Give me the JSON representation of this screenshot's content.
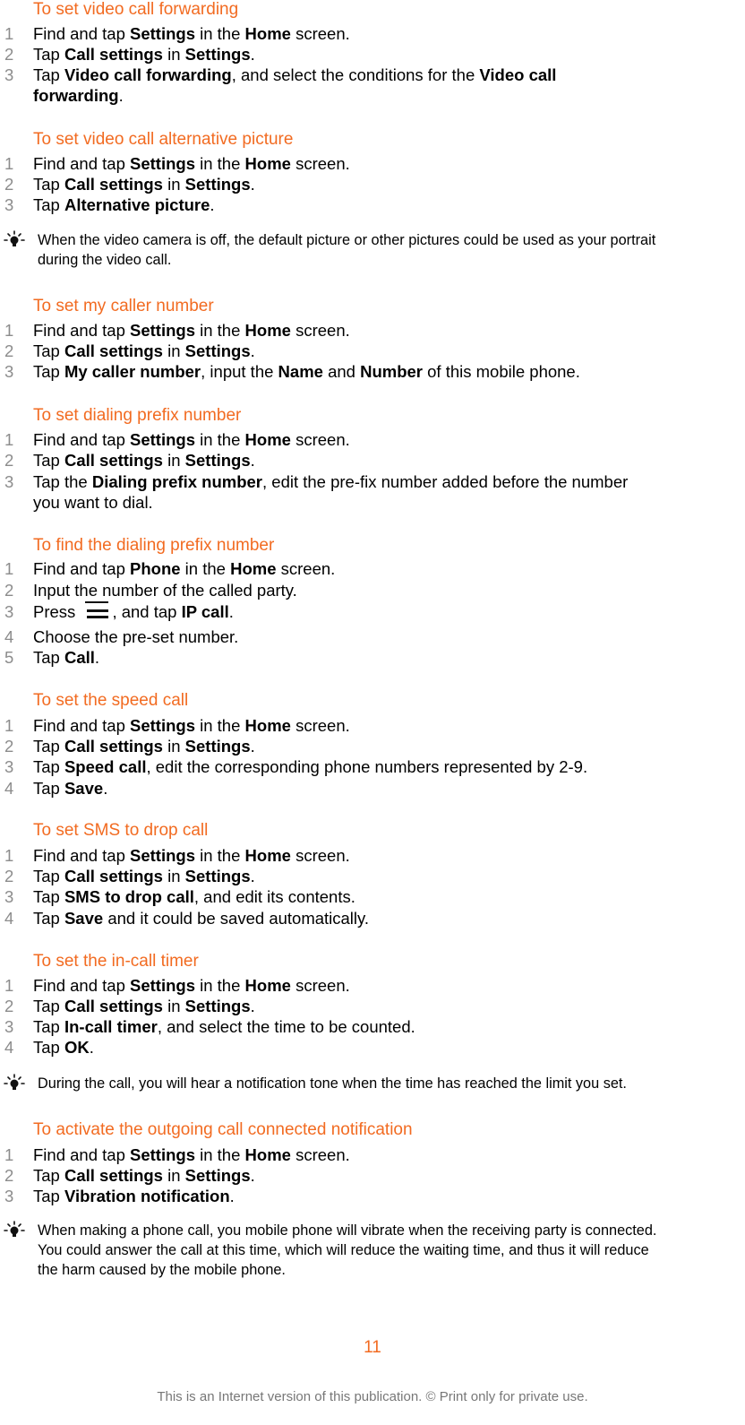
{
  "sections": [
    {
      "heading": "To set video call forwarding",
      "steps": [
        {
          "num": "1",
          "parts": [
            [
              "Find and tap ",
              false
            ],
            [
              "Settings",
              true
            ],
            [
              " in the ",
              false
            ],
            [
              "Home",
              true
            ],
            [
              " screen.",
              false
            ]
          ]
        },
        {
          "num": "2",
          "parts": [
            [
              "Tap ",
              false
            ],
            [
              "Call settings",
              true
            ],
            [
              " in ",
              false
            ],
            [
              "Settings",
              true
            ],
            [
              ".",
              false
            ]
          ]
        },
        {
          "num": "3",
          "parts": [
            [
              "Tap ",
              false
            ],
            [
              "Video call forwarding",
              true
            ],
            [
              ", and select the conditions for the ",
              false
            ],
            [
              "Video call",
              true
            ]
          ],
          "cont": [
            [
              "forwarding",
              true
            ],
            [
              ".",
              false
            ]
          ]
        }
      ]
    },
    {
      "heading": "To set video call alternative picture",
      "steps": [
        {
          "num": "1",
          "parts": [
            [
              "Find and tap ",
              false
            ],
            [
              "Settings",
              true
            ],
            [
              " in the ",
              false
            ],
            [
              "Home",
              true
            ],
            [
              " screen.",
              false
            ]
          ]
        },
        {
          "num": "2",
          "parts": [
            [
              "Tap ",
              false
            ],
            [
              "Call settings",
              true
            ],
            [
              " in ",
              false
            ],
            [
              "Settings",
              true
            ],
            [
              ".",
              false
            ]
          ]
        },
        {
          "num": "3",
          "parts": [
            [
              "Tap ",
              false
            ],
            [
              "Alternative picture",
              true
            ],
            [
              ".",
              false
            ]
          ]
        }
      ],
      "note": [
        "When the video camera is off, the default picture or other pictures could be used as your portrait",
        "during the video call."
      ]
    },
    {
      "heading": "To set my caller number",
      "steps": [
        {
          "num": "1",
          "parts": [
            [
              "Find and tap ",
              false
            ],
            [
              "Settings",
              true
            ],
            [
              " in the ",
              false
            ],
            [
              "Home",
              true
            ],
            [
              " screen.",
              false
            ]
          ]
        },
        {
          "num": "2",
          "parts": [
            [
              "Tap ",
              false
            ],
            [
              "Call settings",
              true
            ],
            [
              " in ",
              false
            ],
            [
              "Settings",
              true
            ],
            [
              ".",
              false
            ]
          ]
        },
        {
          "num": "3",
          "parts": [
            [
              "Tap ",
              false
            ],
            [
              "My caller number",
              true
            ],
            [
              ", input the ",
              false
            ],
            [
              "Name",
              true
            ],
            [
              " and ",
              false
            ],
            [
              "Number",
              true
            ],
            [
              " of this mobile phone.",
              false
            ]
          ]
        }
      ]
    },
    {
      "heading": "To set dialing prefix number",
      "steps": [
        {
          "num": "1",
          "parts": [
            [
              "Find and tap ",
              false
            ],
            [
              "Settings",
              true
            ],
            [
              " in the ",
              false
            ],
            [
              "Home",
              true
            ],
            [
              " screen.",
              false
            ]
          ]
        },
        {
          "num": "2",
          "parts": [
            [
              "Tap ",
              false
            ],
            [
              "Call settings",
              true
            ],
            [
              " in ",
              false
            ],
            [
              "Settings",
              true
            ],
            [
              ".",
              false
            ]
          ]
        },
        {
          "num": "3",
          "parts": [
            [
              "Tap the ",
              false
            ],
            [
              "Dialing prefix number",
              true
            ],
            [
              ", edit the pre-fix number added before the number",
              false
            ]
          ],
          "cont": [
            [
              "you want to dial.",
              false
            ]
          ]
        }
      ]
    },
    {
      "heading": "To find the dialing prefix number",
      "steps": [
        {
          "num": "1",
          "parts": [
            [
              "Find and tap ",
              false
            ],
            [
              "Phone",
              true
            ],
            [
              " in the ",
              false
            ],
            [
              "Home",
              true
            ],
            [
              " screen.",
              false
            ]
          ]
        },
        {
          "num": "2",
          "parts": [
            [
              "Input the number of the called party.",
              false
            ]
          ]
        },
        {
          "num": "3",
          "parts": [
            [
              "Press ",
              false
            ],
            [
              "{menu-icon}",
              false
            ],
            [
              ", and tap ",
              false
            ],
            [
              "IP call",
              true
            ],
            [
              ".",
              false
            ]
          ]
        },
        {
          "num": "4",
          "parts": [
            [
              "Choose the pre-set number.",
              false
            ]
          ]
        },
        {
          "num": "5",
          "parts": [
            [
              "Tap ",
              false
            ],
            [
              "Call",
              true
            ],
            [
              ".",
              false
            ]
          ]
        }
      ]
    },
    {
      "heading": "To set the speed call",
      "steps": [
        {
          "num": "1",
          "parts": [
            [
              "Find and tap ",
              false
            ],
            [
              "Settings",
              true
            ],
            [
              " in the ",
              false
            ],
            [
              "Home",
              true
            ],
            [
              " screen.",
              false
            ]
          ]
        },
        {
          "num": "2",
          "parts": [
            [
              "Tap ",
              false
            ],
            [
              "Call settings",
              true
            ],
            [
              " in ",
              false
            ],
            [
              "Settings",
              true
            ],
            [
              ".",
              false
            ]
          ]
        },
        {
          "num": "3",
          "parts": [
            [
              "Tap ",
              false
            ],
            [
              "Speed call",
              true
            ],
            [
              ", edit the corresponding phone numbers represented by 2-9.",
              false
            ]
          ]
        },
        {
          "num": "4",
          "parts": [
            [
              "Tap ",
              false
            ],
            [
              "Save",
              true
            ],
            [
              ".",
              false
            ]
          ]
        }
      ]
    },
    {
      "heading": "To set SMS to drop call",
      "steps": [
        {
          "num": "1",
          "parts": [
            [
              "Find and tap ",
              false
            ],
            [
              "Settings",
              true
            ],
            [
              " in the ",
              false
            ],
            [
              "Home",
              true
            ],
            [
              " screen.",
              false
            ]
          ]
        },
        {
          "num": "2",
          "parts": [
            [
              "Tap ",
              false
            ],
            [
              "Call settings",
              true
            ],
            [
              " in ",
              false
            ],
            [
              "Settings",
              true
            ],
            [
              ".",
              false
            ]
          ]
        },
        {
          "num": "3",
          "parts": [
            [
              "Tap ",
              false
            ],
            [
              "SMS to drop call",
              true
            ],
            [
              ", and edit its contents.",
              false
            ]
          ]
        },
        {
          "num": "4",
          "parts": [
            [
              "Tap ",
              false
            ],
            [
              "Save",
              true
            ],
            [
              " and it could be saved automatically.",
              false
            ]
          ]
        }
      ]
    },
    {
      "heading": "To set the in-call timer",
      "steps": [
        {
          "num": "1",
          "parts": [
            [
              "Find and tap ",
              false
            ],
            [
              "Settings",
              true
            ],
            [
              " in the ",
              false
            ],
            [
              "Home",
              true
            ],
            [
              " screen.",
              false
            ]
          ]
        },
        {
          "num": "2",
          "parts": [
            [
              "Tap ",
              false
            ],
            [
              "Call settings",
              true
            ],
            [
              " in ",
              false
            ],
            [
              "Settings",
              true
            ],
            [
              ".",
              false
            ]
          ]
        },
        {
          "num": "3",
          "parts": [
            [
              "Tap ",
              false
            ],
            [
              "In-call timer",
              true
            ],
            [
              ", and select the time to be counted.",
              false
            ]
          ]
        },
        {
          "num": "4",
          "parts": [
            [
              "Tap ",
              false
            ],
            [
              "OK",
              true
            ],
            [
              ".",
              false
            ]
          ]
        }
      ],
      "note": [
        "During the call, you will hear a notification tone when the time has reached the limit you set."
      ]
    },
    {
      "heading": "To activate the outgoing call connected notification",
      "steps": [
        {
          "num": "1",
          "parts": [
            [
              "Find and tap ",
              false
            ],
            [
              "Settings",
              true
            ],
            [
              " in the ",
              false
            ],
            [
              "Home",
              true
            ],
            [
              " screen.",
              false
            ]
          ]
        },
        {
          "num": "2",
          "parts": [
            [
              "Tap ",
              false
            ],
            [
              "Call settings",
              true
            ],
            [
              " in ",
              false
            ],
            [
              "Settings",
              true
            ],
            [
              ".",
              false
            ]
          ]
        },
        {
          "num": "3",
          "parts": [
            [
              "Tap ",
              false
            ],
            [
              "Vibration notification",
              true
            ],
            [
              ".",
              false
            ]
          ]
        }
      ],
      "note": [
        "When making a phone call, you mobile phone will vibrate when the receiving party is connected.",
        "You could answer the call at this time, which will reduce the waiting time, and thus it will reduce",
        "the harm caused by the mobile phone."
      ]
    }
  ],
  "page_number": "11",
  "footer": "This is an Internet version of this publication. © Print only for private use.",
  "colors": {
    "heading": "#f26b21",
    "step_number": "#8c8c8c",
    "page_number": "#f26b21",
    "footer": "#777777"
  },
  "icons": {
    "tip": "lightbulb-icon",
    "menu": "menu-icon"
  }
}
